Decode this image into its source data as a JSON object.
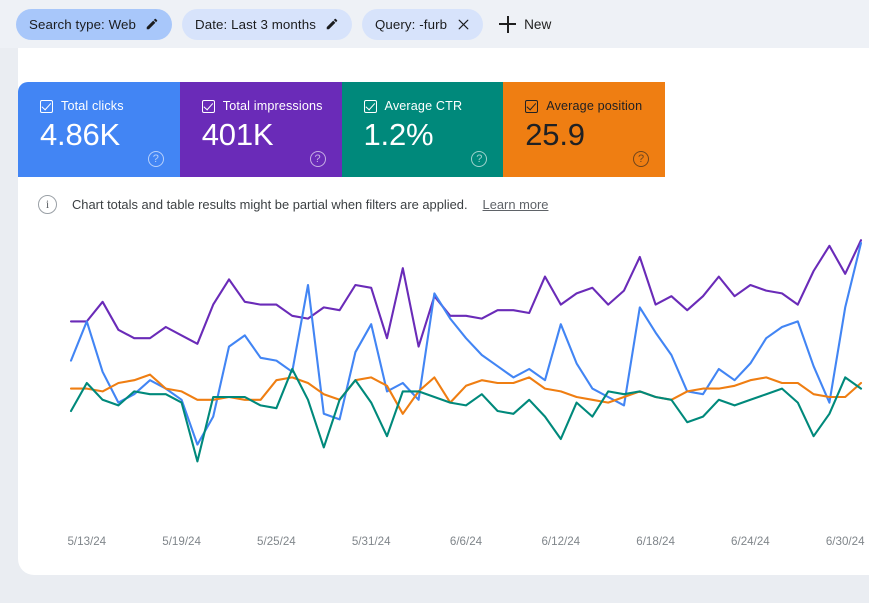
{
  "filters": {
    "chips": [
      {
        "label": "Search type: Web",
        "icon": "pencil-icon",
        "style": "active",
        "name": "filter-chip-search-type"
      },
      {
        "label": "Date: Last 3 months",
        "icon": "pencil-icon",
        "style": "plain",
        "name": "filter-chip-date"
      },
      {
        "label": "Query: -furb",
        "icon": "close-icon",
        "style": "plain",
        "name": "filter-chip-query"
      }
    ],
    "new_button": {
      "label": "New",
      "icon": "plus-icon"
    }
  },
  "metric_cards": [
    {
      "label": "Total clicks",
      "value": "4.86K",
      "color": "#4285f4",
      "text": "light",
      "checked": true,
      "help": "?"
    },
    {
      "label": "Total impressions",
      "value": "401K",
      "color": "#6a2bb8",
      "text": "light",
      "checked": true,
      "help": "?"
    },
    {
      "label": "Average CTR",
      "value": "1.2%",
      "color": "#00897b",
      "text": "light",
      "checked": true,
      "help": "?"
    },
    {
      "label": "Average position",
      "value": "25.9",
      "color": "#ef7e12",
      "text": "dark",
      "checked": true,
      "help": "?"
    }
  ],
  "notice": {
    "icon": "info-icon",
    "text": "Chart totals and table results might be partial when filters are applied.",
    "link_label": "Learn more"
  },
  "chart_data": {
    "type": "line",
    "title": "",
    "xlabel": "",
    "ylabel": "",
    "grid": false,
    "legend": "none",
    "x_tick_labels": [
      "5/13/24",
      "5/19/24",
      "5/25/24",
      "5/31/24",
      "6/6/24",
      "6/12/24",
      "6/18/24",
      "6/24/24",
      "6/30/24"
    ],
    "x_tick_indices": [
      1,
      7,
      13,
      19,
      25,
      31,
      37,
      43,
      49
    ],
    "x_count": 51,
    "ylim": [
      0,
      100
    ],
    "series": [
      {
        "name": "Total impressions",
        "color": "#6a2bb8",
        "values": [
          72,
          72,
          79,
          69,
          66,
          66,
          70,
          67,
          64,
          78,
          87,
          79,
          78,
          78,
          74,
          73,
          77,
          76,
          85,
          84,
          66,
          91,
          63,
          81,
          74,
          74,
          73,
          76,
          76,
          75,
          88,
          78,
          82,
          84,
          78,
          83,
          95,
          78,
          81,
          76,
          81,
          88,
          81,
          85,
          83,
          82,
          78,
          90,
          99,
          89,
          101
        ]
      },
      {
        "name": "Total clicks",
        "color": "#4285f4",
        "values": [
          58,
          72,
          54,
          43,
          46,
          51,
          48,
          44,
          28,
          38,
          63,
          67,
          59,
          58,
          54,
          85,
          39,
          37,
          61,
          71,
          47,
          50,
          44,
          82,
          73,
          66,
          60,
          56,
          52,
          55,
          51,
          71,
          57,
          48,
          45,
          42,
          77,
          68,
          60,
          47,
          46,
          55,
          51,
          57,
          66,
          70,
          72,
          56,
          43,
          77,
          100
        ]
      },
      {
        "name": "Average position",
        "color": "#ef7e12",
        "values": [
          48,
          48,
          47,
          50,
          51,
          53,
          48,
          47,
          44,
          44,
          45,
          44,
          44,
          51,
          52,
          50,
          46,
          44,
          51,
          52,
          49,
          39,
          47,
          52,
          43,
          49,
          51,
          50,
          50,
          52,
          48,
          47,
          45,
          44,
          43,
          45,
          47,
          45,
          44,
          47,
          48,
          48,
          49,
          51,
          52,
          50,
          50,
          46,
          45,
          45,
          50,
          48
        ]
      },
      {
        "name": "Average CTR",
        "color": "#00897b",
        "values": [
          40,
          50,
          44,
          42,
          47,
          46,
          46,
          43,
          22,
          45,
          45,
          45,
          42,
          41,
          55,
          44,
          27,
          44,
          51,
          43,
          31,
          47,
          47,
          45,
          43,
          42,
          46,
          40,
          39,
          44,
          38,
          30,
          43,
          38,
          47,
          46,
          47,
          45,
          44,
          36,
          38,
          44,
          42,
          44,
          46,
          48,
          43,
          31,
          39,
          52,
          48
        ]
      }
    ]
  }
}
